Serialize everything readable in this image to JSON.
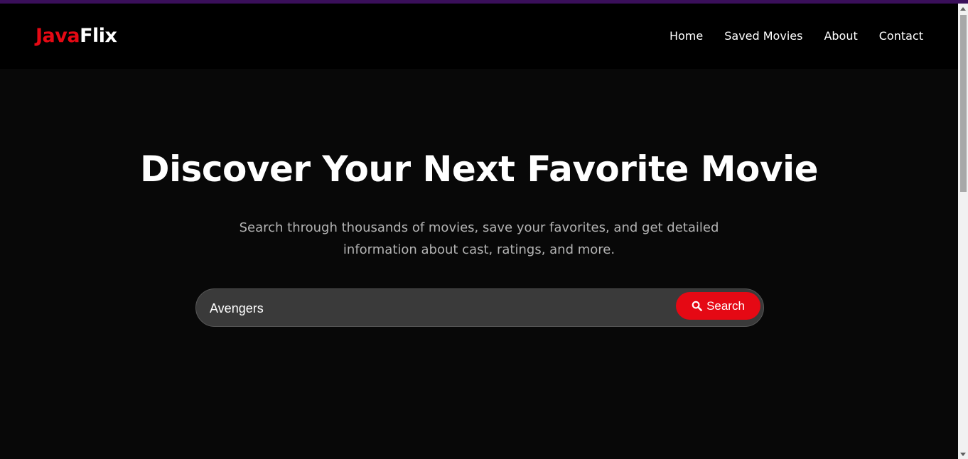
{
  "brand": {
    "part1": "Java",
    "part2": "Flix",
    "accent_color": "#e50914"
  },
  "nav": {
    "items": [
      {
        "label": "Home"
      },
      {
        "label": "Saved Movies"
      },
      {
        "label": "About"
      },
      {
        "label": "Contact"
      }
    ]
  },
  "hero": {
    "title": "Discover Your Next Favorite Movie",
    "subtitle": "Search through thousands of movies, save your favorites, and get detailed information about cast, ratings, and more."
  },
  "search": {
    "value": "Avengers",
    "button_label": "Search",
    "button_icon": "search-icon"
  },
  "colors": {
    "background": "#080808",
    "navbar": "#000000",
    "search_field": "#3a3a3a",
    "button": "#e50914"
  }
}
